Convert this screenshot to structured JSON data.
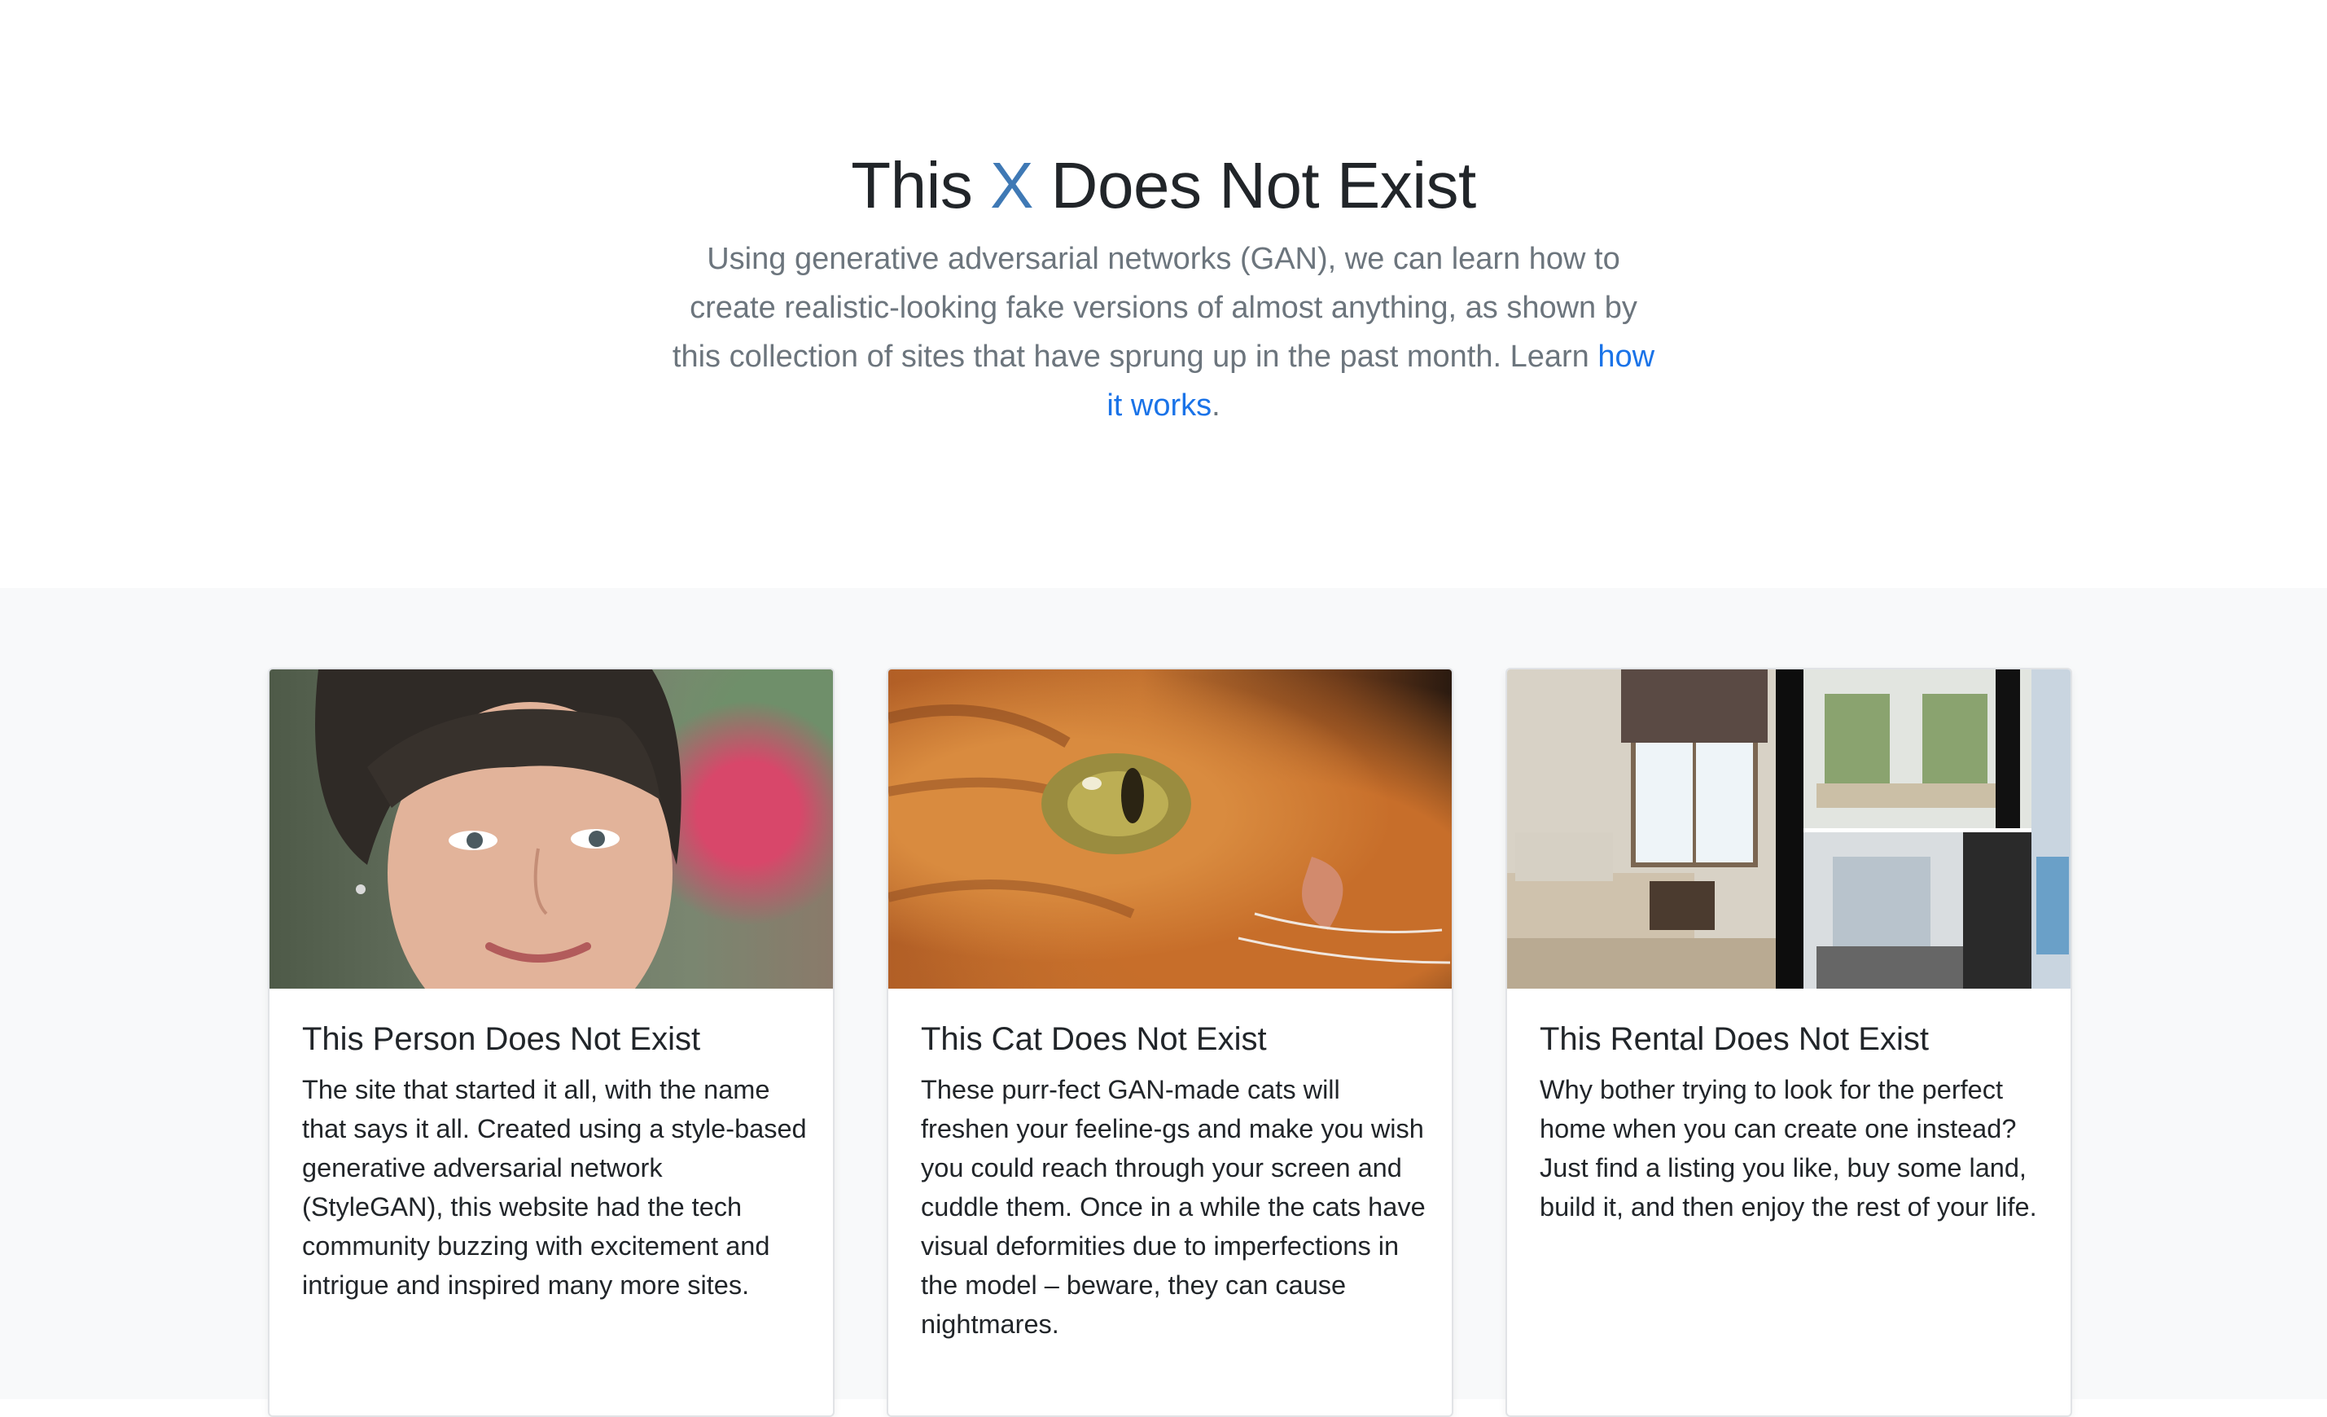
{
  "hero": {
    "title_pre": "This ",
    "title_x": "X",
    "title_post": " Does Not Exist",
    "lead_text": "Using generative adversarial networks (GAN), we can learn how to create realistic-looking fake versions of almost anything, as shown by this collection of sites that have sprung up in the past month. Learn ",
    "lead_link": "how it works",
    "lead_end": "."
  },
  "colors": {
    "accent_x": "#3f79b5",
    "link": "#1a73e8",
    "muted_text": "#6c757d",
    "album_bg": "#f8f9fa"
  },
  "cards": [
    {
      "title": "This Person Does Not Exist",
      "text": "The site that started it all, with the name that says it all. Created using a style-based generative adversarial network (StyleGAN), this website had the tech community buzzing with excitement and intrigue and inspired many more sites.",
      "image": "generated-person-photo"
    },
    {
      "title": "This Cat Does Not Exist",
      "text": "These purr-fect GAN-made cats will freshen your feeline-gs and make you wish you could reach through your screen and cuddle them. Once in a while the cats have visual deformities due to imperfections in the model – beware, they can cause nightmares.",
      "image": "generated-cat-photo"
    },
    {
      "title": "This Rental Does Not Exist",
      "text": "Why bother trying to look for the perfect home when you can create one instead? Just find a listing you like, buy some land, build it, and then enjoy the rest of your life.",
      "image": "generated-rental-collage"
    }
  ]
}
